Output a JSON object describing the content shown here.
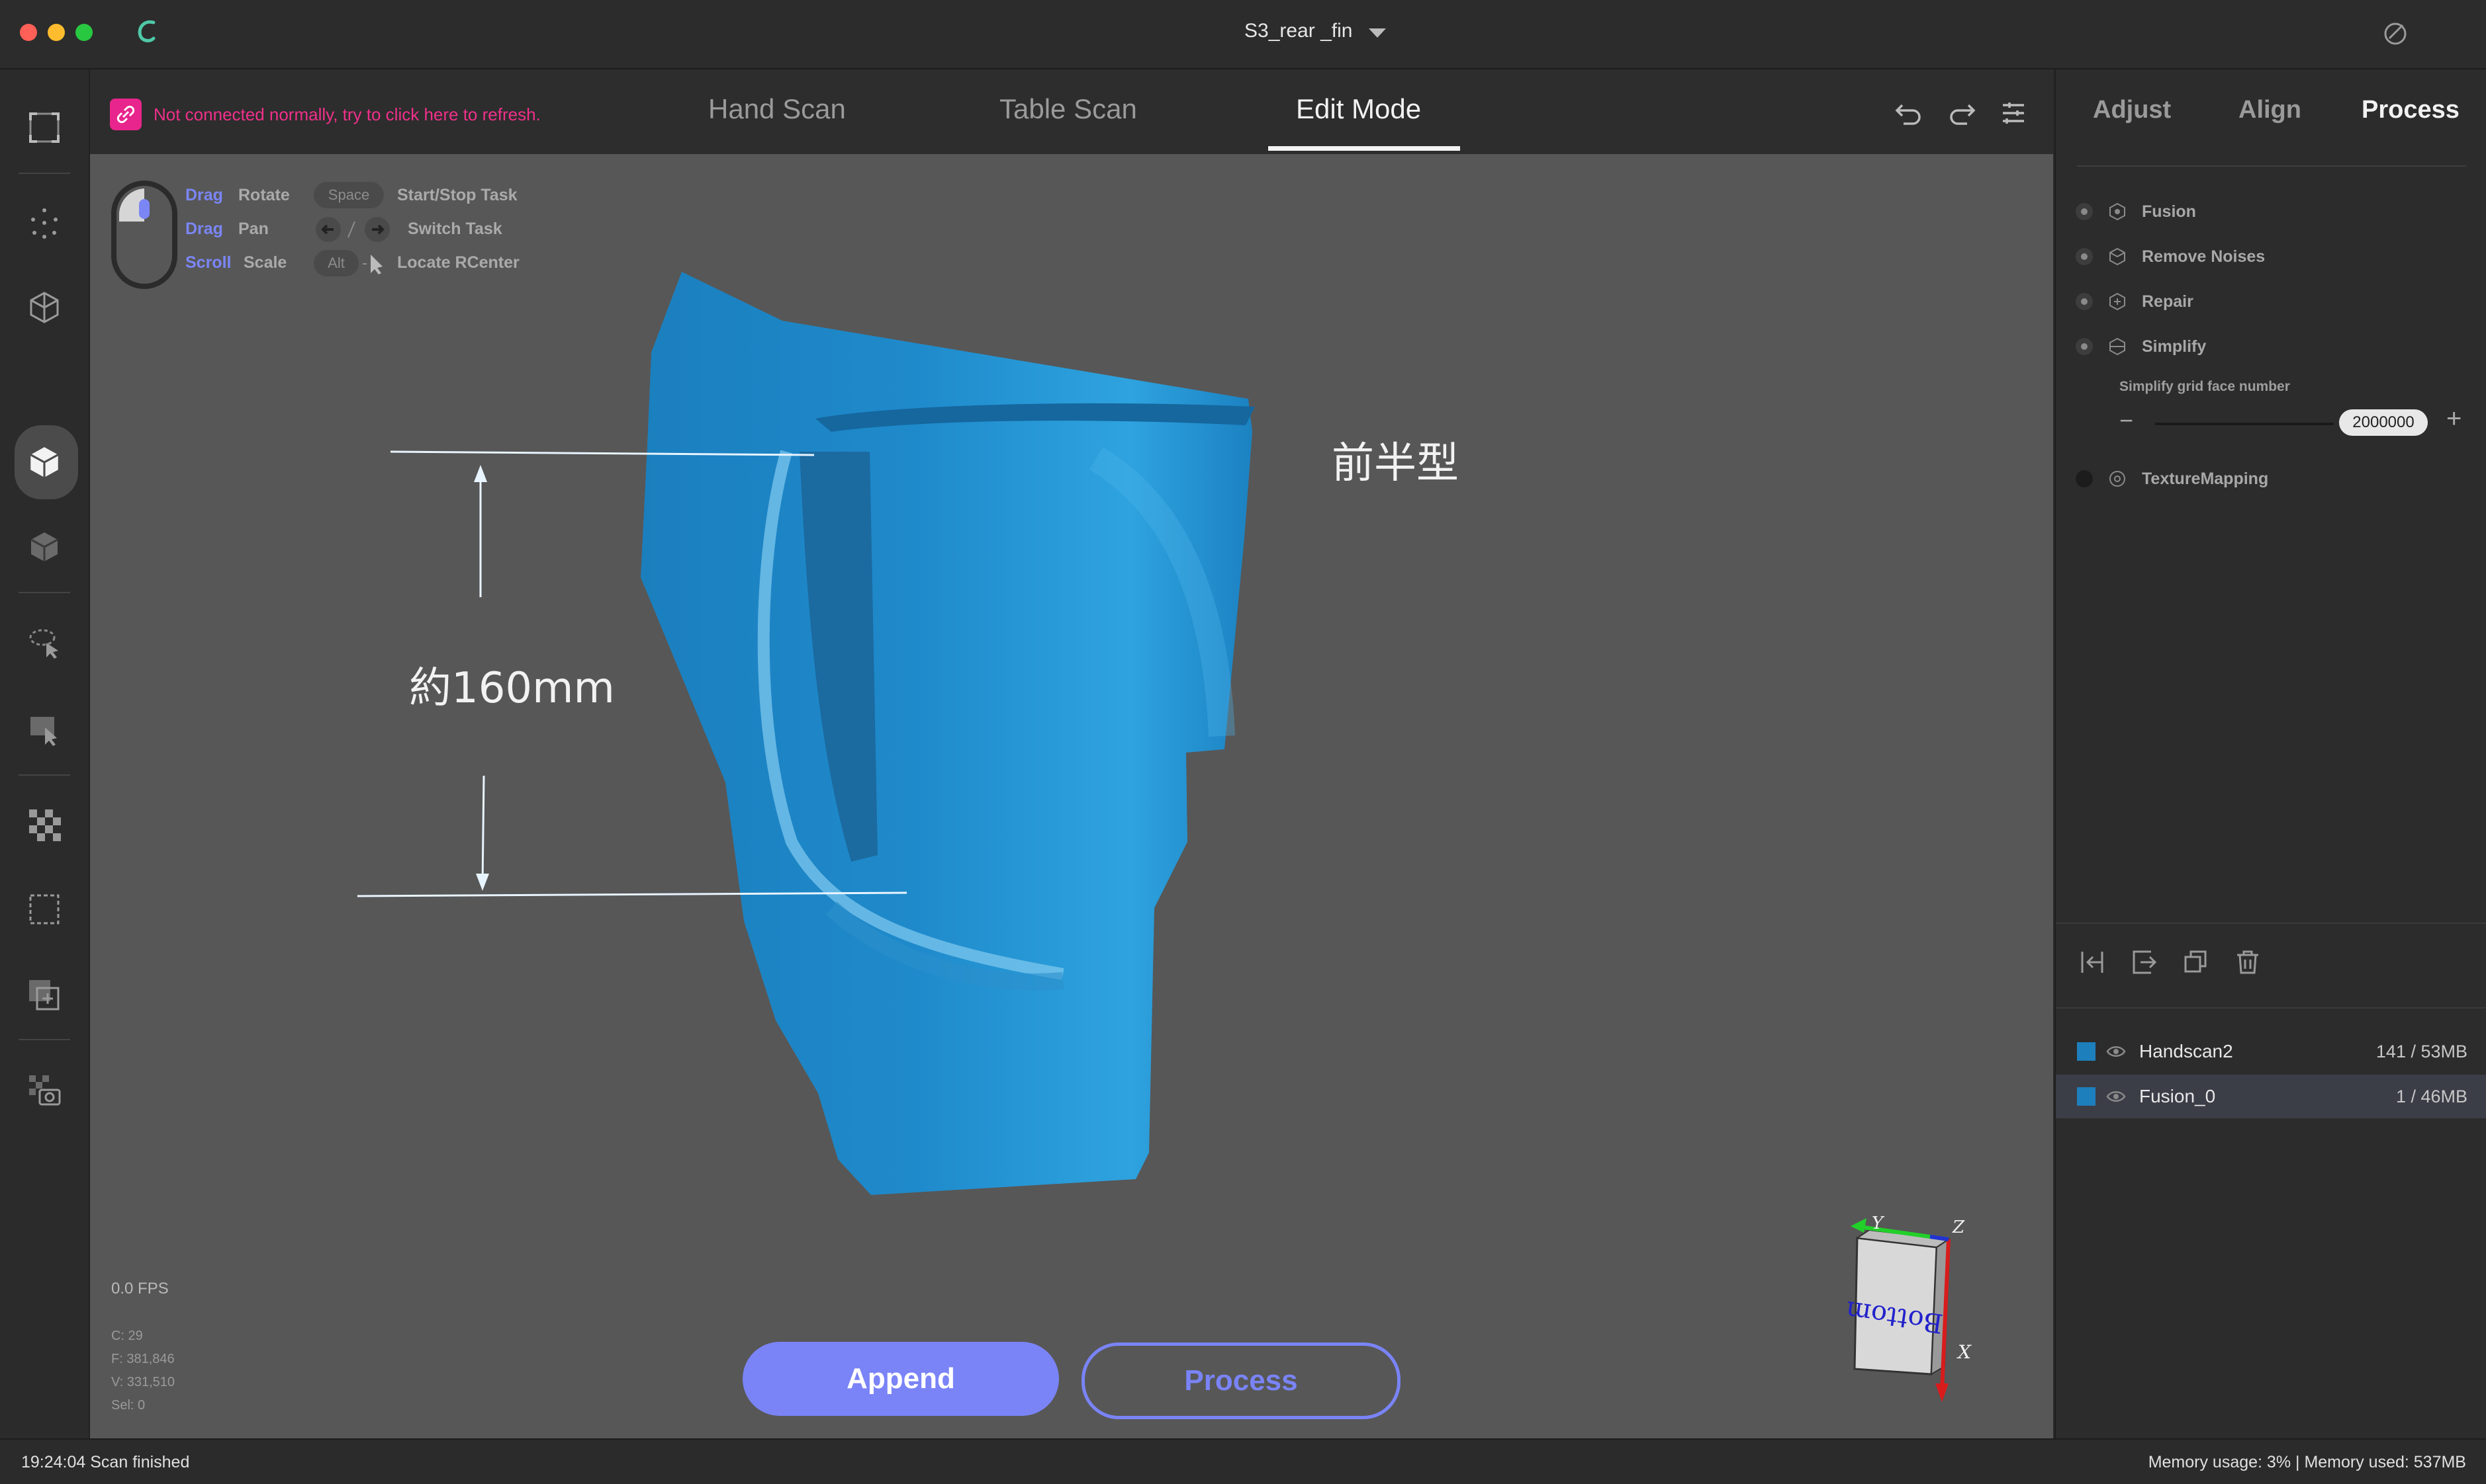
{
  "window": {
    "title": "S3_rear _fin"
  },
  "toolbar": {
    "notice": "Not connected normally, try to click here to refresh.",
    "tabs": [
      {
        "label": "Hand Scan"
      },
      {
        "label": "Table Scan"
      },
      {
        "label": "Edit Mode"
      }
    ]
  },
  "hints": {
    "row1": {
      "action": "Drag",
      "effect": "Rotate",
      "key": "Space",
      "task": "Start/Stop Task"
    },
    "row2": {
      "action": "Drag",
      "effect": "Pan",
      "task": "Switch Task"
    },
    "row3": {
      "action": "Scroll",
      "effect": "Scale",
      "key": "Alt",
      "task": "Locate RCenter"
    }
  },
  "annotations": {
    "dimension": "約160mm",
    "part_name": "前半型"
  },
  "stats": {
    "fps": "0.0 FPS",
    "c": "C: 29",
    "f": "F: 381,846",
    "v": "V: 331,510",
    "sel": "Sel: 0"
  },
  "buttons": {
    "append": "Append",
    "process": "Process"
  },
  "orient_cube": {
    "face": "Bottom",
    "x": "X",
    "y": "Y",
    "z": "Z"
  },
  "right_panel": {
    "tabs": [
      {
        "label": "Adjust"
      },
      {
        "label": "Align"
      },
      {
        "label": "Process"
      }
    ],
    "process_items": [
      {
        "label": "Fusion"
      },
      {
        "label": "Remove Noises"
      },
      {
        "label": "Repair"
      },
      {
        "label": "Simplify"
      }
    ],
    "simplify_label": "Simplify grid face number",
    "simplify_value": "2000000",
    "texture_label": "TextureMapping",
    "layers": [
      {
        "name": "Handscan2",
        "stat": "141 / 53MB"
      },
      {
        "name": "Fusion_0",
        "stat": "1 / 46MB"
      }
    ]
  },
  "status": {
    "left": "19:24:04 Scan finished",
    "right": "Memory usage: 3% | Memory used: 537MB"
  },
  "colors": {
    "accent": "#7a84f7",
    "scan_blue": "#1f86c4",
    "notice_pink": "#f0308a",
    "layer_color": "#1e7fbd"
  }
}
